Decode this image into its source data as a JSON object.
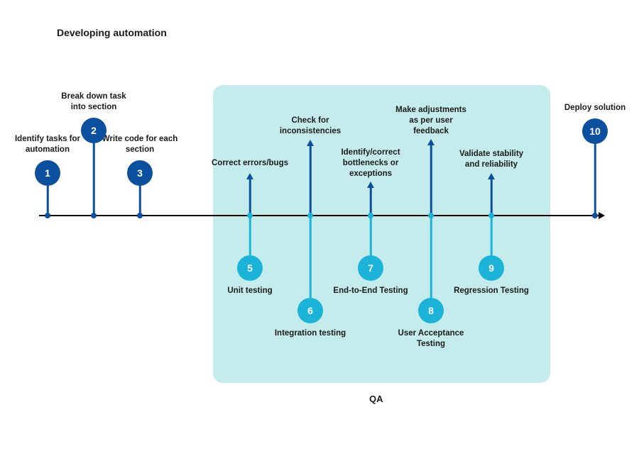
{
  "title": "Developing automation",
  "qa_section_label": "QA",
  "steps": {
    "s1": {
      "num": "1",
      "label": "Identify tasks for automation"
    },
    "s2": {
      "num": "2",
      "label": "Break down task into section"
    },
    "s3": {
      "num": "3",
      "label": "Write code for each section"
    },
    "s5": {
      "num": "5",
      "label": "Unit testing"
    },
    "s6": {
      "num": "6",
      "label": "Integration testing"
    },
    "s7": {
      "num": "7",
      "label": "End-to-End Testing"
    },
    "s8": {
      "num": "8",
      "label": "User Acceptance Testing"
    },
    "s9": {
      "num": "9",
      "label": "Regression Testing"
    },
    "s10": {
      "num": "10",
      "label": "Deploy solution"
    }
  },
  "arrows": {
    "a5": "Correct errors/bugs",
    "a6": "Check for inconsistencies",
    "a7": "Identify/correct bottlenecks or exceptions",
    "a8": "Make adjustments as per user feedback",
    "a9": "Validate stability and reliability"
  }
}
